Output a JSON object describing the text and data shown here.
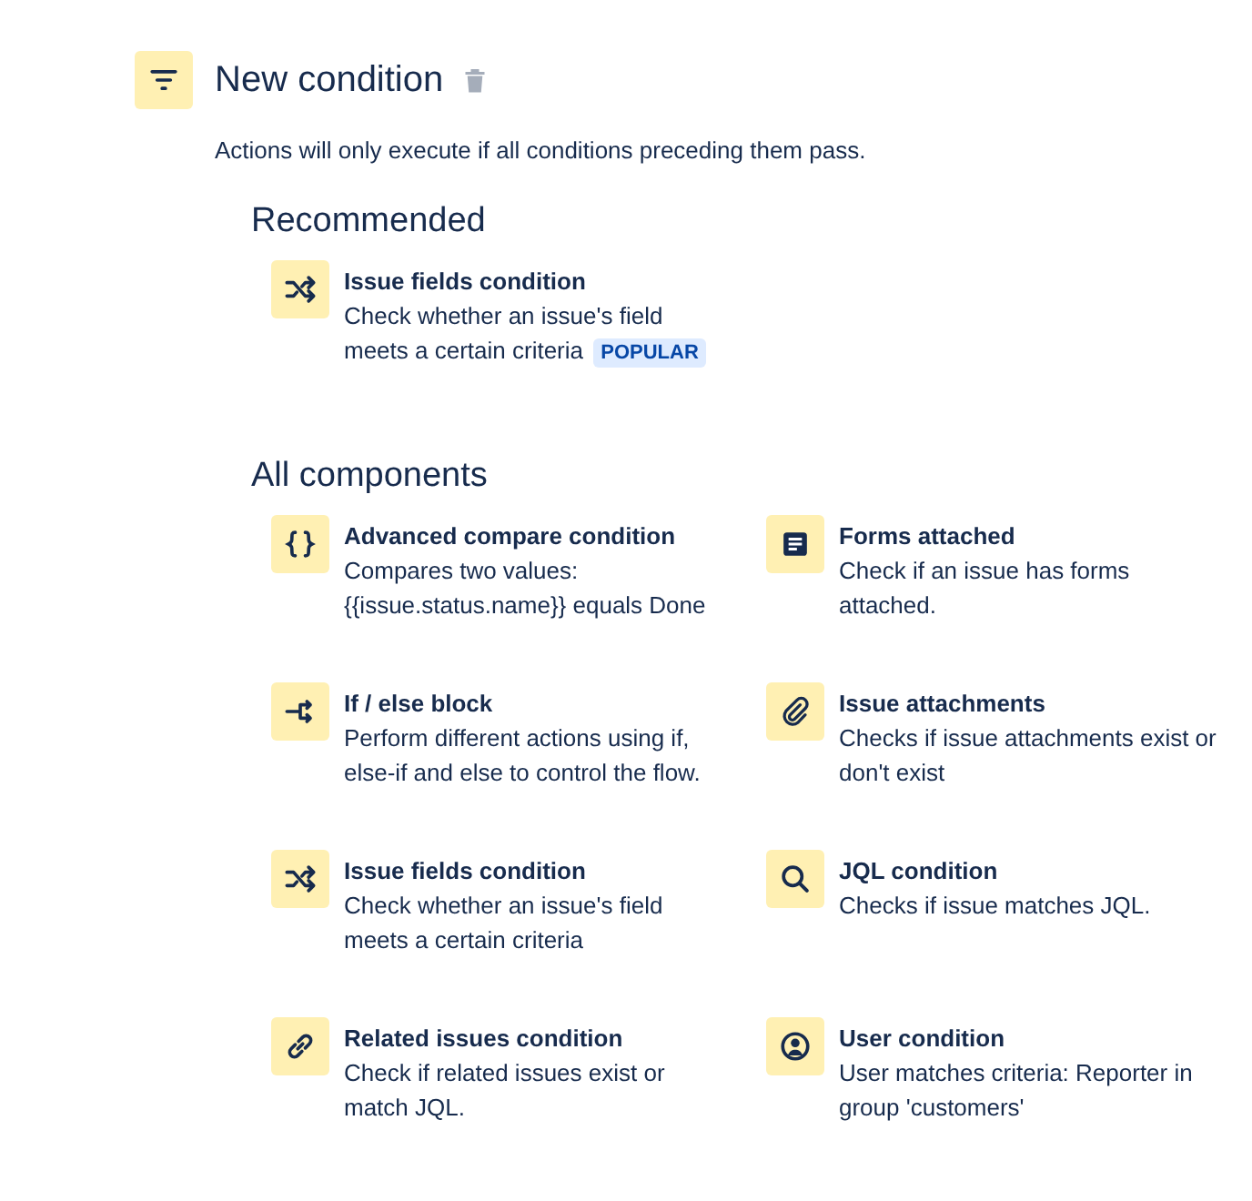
{
  "header": {
    "title": "New condition",
    "description": "Actions will only execute if all conditions preceding them pass."
  },
  "sections": [
    {
      "title": "Recommended",
      "items": [
        {
          "kind": "shuffle",
          "title": "Issue fields condition",
          "description": "Check whether an issue's field meets a certain criteria",
          "badge": "POPULAR"
        }
      ]
    },
    {
      "title": "All components",
      "items": [
        {
          "kind": "braces",
          "title": "Advanced compare condition",
          "description": "Compares two values: {{issue.status.name}} equals Done"
        },
        {
          "kind": "form",
          "title": "Forms attached",
          "description": "Check if an issue has forms attached."
        },
        {
          "kind": "branch",
          "title": "If / else block",
          "description": "Perform different actions using if, else-if and else to control the flow."
        },
        {
          "kind": "paperclip",
          "title": "Issue attachments",
          "description": "Checks if issue attachments exist or don't exist"
        },
        {
          "kind": "shuffle",
          "title": "Issue fields condition",
          "description": "Check whether an issue's field meets a certain criteria"
        },
        {
          "kind": "search",
          "title": "JQL condition",
          "description": "Checks if issue matches JQL."
        },
        {
          "kind": "link",
          "title": "Related issues condition",
          "description": "Check if related issues exist or match JQL."
        },
        {
          "kind": "user",
          "title": "User condition",
          "description": "User matches criteria: Reporter in group 'customers'"
        }
      ]
    }
  ]
}
